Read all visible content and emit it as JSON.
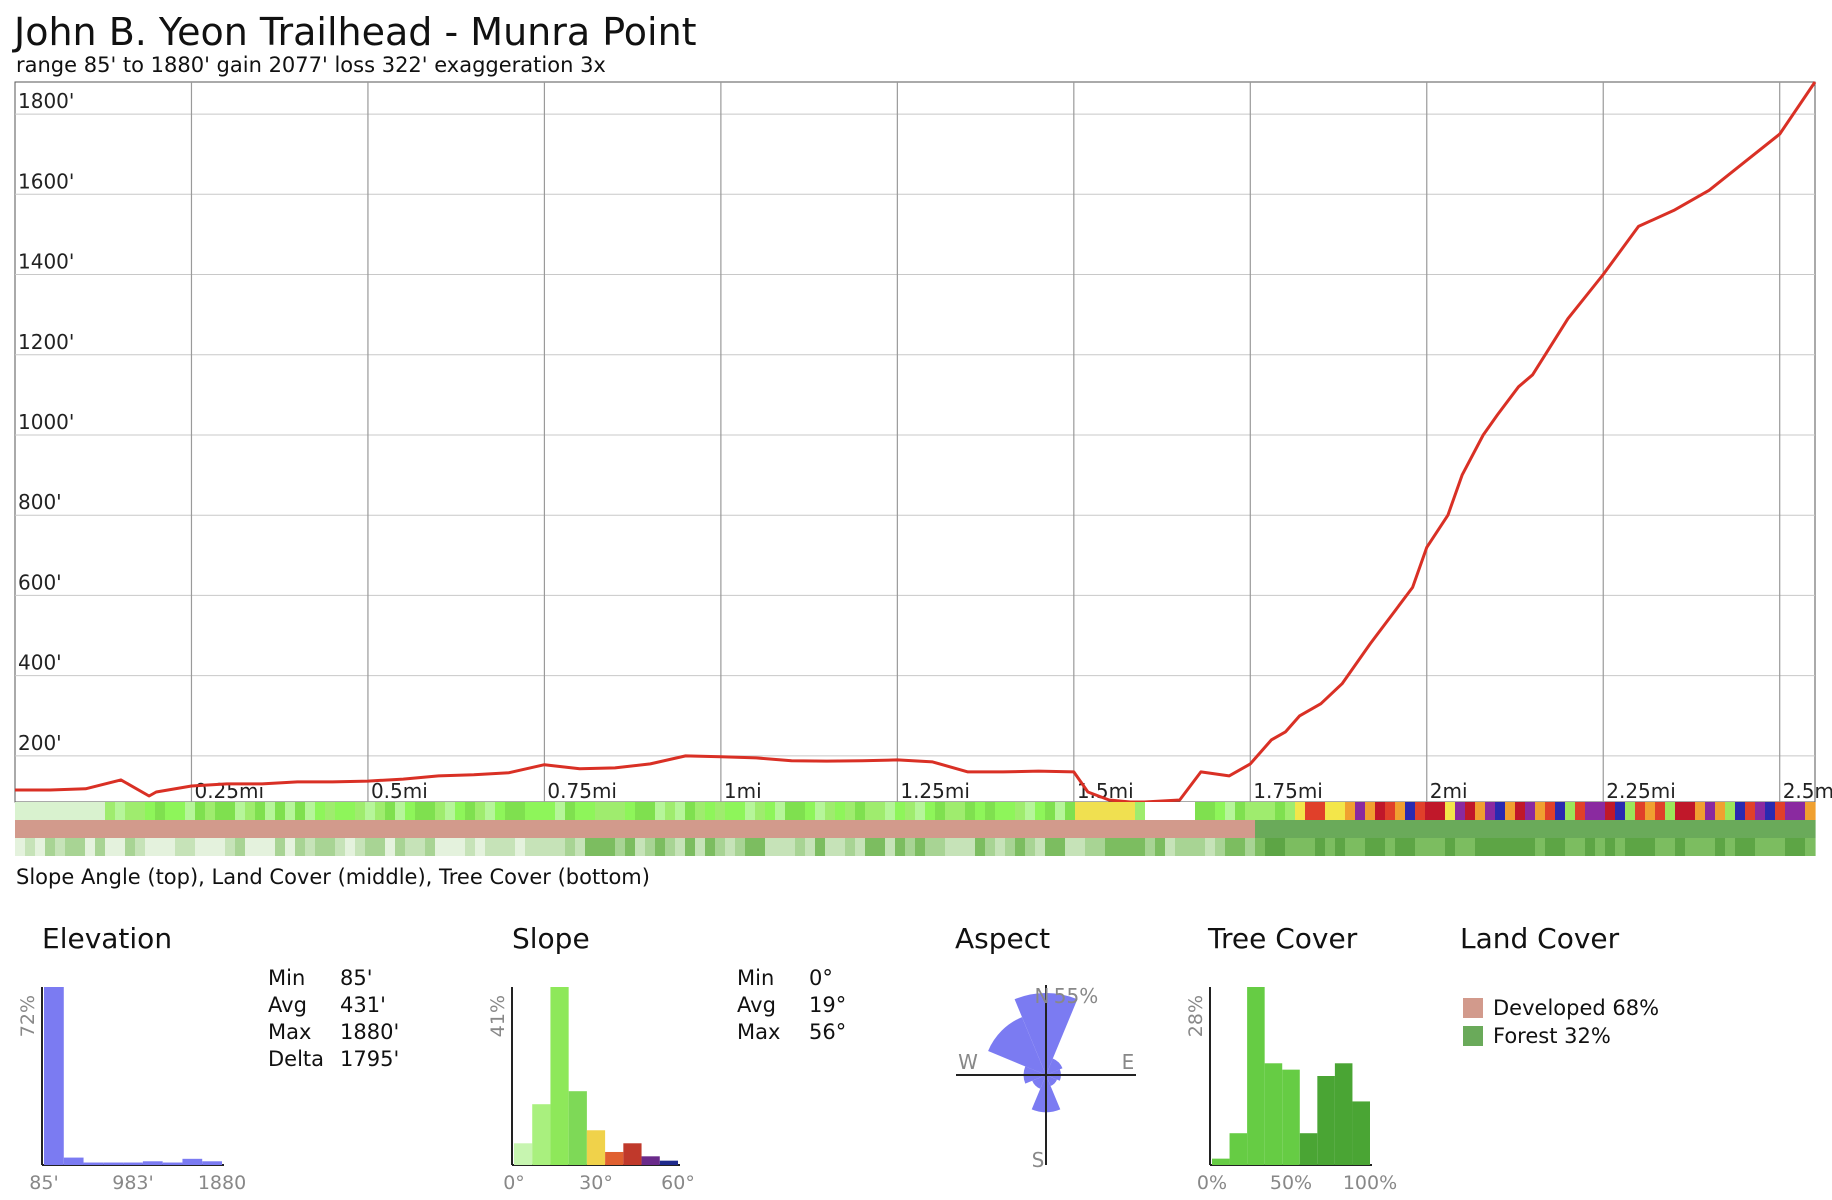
{
  "title": "John B. Yeon Trailhead - Munra Point",
  "subtitle": "range 85' to 1880'  gain 2077'  loss 322'  exaggeration 3x",
  "strip_caption": "Slope Angle (top), Land Cover (middle), Tree Cover (bottom)",
  "colors": {
    "profile_line": "#d93025",
    "grid": "#c8c8c8",
    "slope_low": "#8ef55a",
    "slope_high": "#c0392b",
    "developed": "#d29a8c",
    "forest": "#6aaa5a",
    "elevation_hist": "#7b7bf2",
    "aspect_rose": "#7b7bf2",
    "tree_hist": "#66cc44",
    "tree_hist_dark": "#4aa534"
  },
  "chart_data": [
    {
      "type": "line",
      "name": "elevation-profile",
      "x_unit": "mi",
      "y_unit": "ft",
      "xlim": [
        0,
        2.55
      ],
      "ylim": [
        85,
        1880
      ],
      "x_ticks": [
        0.25,
        0.5,
        0.75,
        1,
        1.25,
        1.5,
        1.75,
        2,
        2.25,
        2.5
      ],
      "x_tick_labels": [
        "0.25mi",
        "0.5mi",
        "0.75mi",
        "1mi",
        "1.25mi",
        "1.5mi",
        "1.75mi",
        "2mi",
        "2.25mi",
        "2.5mi"
      ],
      "y_ticks": [
        200,
        400,
        600,
        800,
        1000,
        1200,
        1400,
        1600,
        1800
      ],
      "y_tick_labels": [
        "200'",
        "400'",
        "600'",
        "800'",
        "1000'",
        "1200'",
        "1400'",
        "1600'",
        "1800'"
      ],
      "grid": true,
      "x": [
        0,
        0.05,
        0.1,
        0.15,
        0.19,
        0.2,
        0.2,
        0.25,
        0.3,
        0.35,
        0.4,
        0.45,
        0.5,
        0.55,
        0.6,
        0.65,
        0.7,
        0.75,
        0.8,
        0.85,
        0.9,
        0.95,
        1.0,
        1.05,
        1.1,
        1.15,
        1.2,
        1.25,
        1.3,
        1.35,
        1.4,
        1.45,
        1.5,
        1.52,
        1.55,
        1.58,
        1.6,
        1.65,
        1.68,
        1.72,
        1.75,
        1.78,
        1.8,
        1.82,
        1.85,
        1.88,
        1.92,
        1.95,
        1.98,
        2.0,
        2.03,
        2.05,
        2.08,
        2.1,
        2.13,
        2.15,
        2.2,
        2.25,
        2.3,
        2.35,
        2.4,
        2.45,
        2.5,
        2.55
      ],
      "y": [
        115,
        115,
        118,
        140,
        100,
        110,
        110,
        125,
        130,
        130,
        135,
        135,
        137,
        142,
        150,
        153,
        158,
        178,
        168,
        170,
        180,
        200,
        198,
        195,
        188,
        187,
        188,
        190,
        185,
        160,
        160,
        162,
        160,
        110,
        90,
        85,
        85,
        90,
        160,
        150,
        180,
        240,
        260,
        300,
        330,
        380,
        480,
        550,
        620,
        720,
        800,
        900,
        1000,
        1050,
        1120,
        1150,
        1290,
        1400,
        1520,
        1560,
        1610,
        1680,
        1750,
        1880
      ]
    },
    {
      "type": "bar",
      "name": "elevation-histogram",
      "title": "Elevation",
      "x_tick_labels": [
        "85'",
        "983'",
        "1880"
      ],
      "y_max_label": "72%",
      "values": [
        72,
        3,
        1,
        1,
        1,
        1.5,
        1,
        2.5,
        1.5
      ]
    },
    {
      "type": "bar",
      "name": "slope-histogram",
      "title": "Slope",
      "x_tick_labels": [
        "0°",
        "30°",
        "60°"
      ],
      "y_max_label": "41%",
      "values": [
        5,
        14,
        41,
        17,
        8,
        3,
        5,
        2,
        1
      ],
      "colors": [
        "#c7f5b0",
        "#a9f07e",
        "#8ee85a",
        "#7ed957",
        "#f0d24a",
        "#e06030",
        "#c0392b",
        "#6a2a8a",
        "#1f2a8c"
      ]
    },
    {
      "type": "pie",
      "name": "aspect-rose",
      "title": "Aspect",
      "direction_labels": [
        "N",
        "E",
        "S",
        "W"
      ],
      "max_label": "55%",
      "directions": [
        "N",
        "NE",
        "E",
        "SE",
        "S",
        "SW",
        "W",
        "NW"
      ],
      "values": [
        55,
        12,
        10,
        8,
        25,
        10,
        15,
        42
      ]
    },
    {
      "type": "bar",
      "name": "tree-cover-histogram",
      "title": "Tree Cover",
      "x_tick_labels": [
        "0%",
        "50%",
        "100%"
      ],
      "y_max_label": "28%",
      "values": [
        1,
        5,
        28,
        16,
        15,
        5,
        14,
        16,
        10
      ]
    }
  ],
  "elevation_stats": [
    {
      "label": "Min",
      "value": "85'"
    },
    {
      "label": "Avg",
      "value": "431'"
    },
    {
      "label": "Max",
      "value": "1880'"
    },
    {
      "label": "Delta",
      "value": "1795'"
    }
  ],
  "slope_stats": [
    {
      "label": "Min",
      "value": "0°"
    },
    {
      "label": "Avg",
      "value": "19°"
    },
    {
      "label": "Max",
      "value": "56°"
    }
  ],
  "land_cover": {
    "title": "Land Cover",
    "items": [
      {
        "label": "Developed 68%",
        "color": "#d29a8c"
      },
      {
        "label": "Forest 32%",
        "color": "#6aaa5a"
      }
    ]
  }
}
